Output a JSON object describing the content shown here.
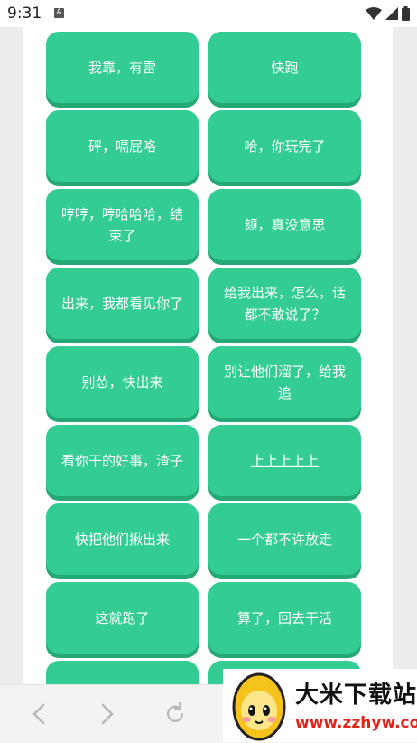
{
  "status": {
    "time": "9:31",
    "badge": "A"
  },
  "buttons": [
    {
      "label": "我靠，有雷"
    },
    {
      "label": "快跑"
    },
    {
      "label": "砰，嗝屁咯"
    },
    {
      "label": "哈，你玩完了"
    },
    {
      "label": "哼哼，哼哈哈哈，结束了"
    },
    {
      "label": "颏，真没意思"
    },
    {
      "label": "出来，我都看见你了"
    },
    {
      "label": "给我出来，怎么，话都不敢说了？"
    },
    {
      "label": "别怂，快出来"
    },
    {
      "label": "别让他们溜了，给我追"
    },
    {
      "label": "看你干的好事，渣子"
    },
    {
      "label": "上上上上上"
    },
    {
      "label": "快把他们揪出来"
    },
    {
      "label": "一个都不许放走"
    },
    {
      "label": "这就跑了"
    },
    {
      "label": "算了，回去干活"
    }
  ],
  "ad": {
    "title": "大米下载站",
    "url": "www.zzhyw.com"
  },
  "colors": {
    "button": "#33cc93",
    "button_shadow": "#24a874",
    "ad_url": "#e0241b"
  },
  "icons": [
    "back-arrow-icon",
    "forward-arrow-icon",
    "reload-icon",
    "wifi-icon",
    "signal-icon",
    "battery-icon"
  ]
}
